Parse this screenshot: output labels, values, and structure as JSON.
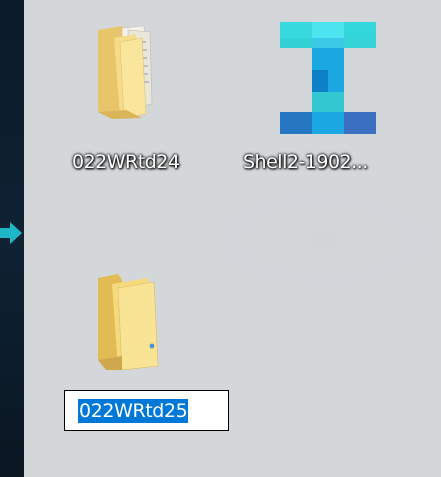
{
  "desktop": {
    "icons": [
      {
        "label": "022WRtd24",
        "icon": "folder-with-documents-icon"
      },
      {
        "label": "Shell2-1902...",
        "icon": "shell-app-icon"
      },
      {
        "label": "022WRtd25",
        "icon": "empty-folder-icon",
        "renaming": true
      }
    ],
    "rename_value": "022WRtd25"
  },
  "colors": {
    "desktop_bg": "#d3d7da",
    "selection": "#0078d7",
    "taskbar_strip": "#0d1a26",
    "arrow": "#1fb6c7"
  }
}
